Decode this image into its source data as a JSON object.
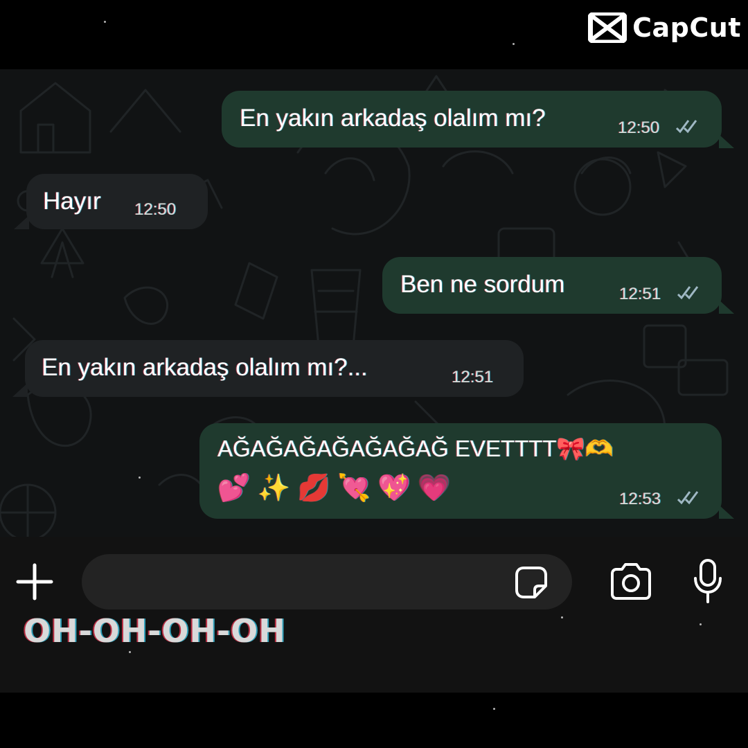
{
  "watermark": {
    "brand": "CapCut"
  },
  "chat": {
    "messages": [
      {
        "direction": "outgoing",
        "text": "En yakın arkadaş olalım mı?",
        "time": "12:50",
        "status": "read"
      },
      {
        "direction": "incoming",
        "text": "Hayır",
        "time": "12:50"
      },
      {
        "direction": "outgoing",
        "text": "Ben ne sordum",
        "time": "12:51",
        "status": "read"
      },
      {
        "direction": "incoming",
        "text": "En yakın arkadaş olalım mı?...",
        "time": "12:51"
      },
      {
        "direction": "outgoing",
        "text": "AĞAĞAĞAĞAĞAĞAĞ EVETTTT🎀🫶",
        "text_line2": "💕 ✨ 💋 💘 💖 💗",
        "time": "12:53",
        "status": "read"
      }
    ]
  },
  "input_bar": {
    "placeholder": "",
    "icons": [
      "plus-icon",
      "sticker-icon",
      "camera-icon",
      "microphone-icon"
    ]
  },
  "caption": "OH-OH-OH-OH",
  "colors": {
    "outgoing_bubble": "#1f3a2e",
    "incoming_bubble": "#1f2224",
    "chat_background": "#111314",
    "read_ticks": "#9fb8c4"
  }
}
